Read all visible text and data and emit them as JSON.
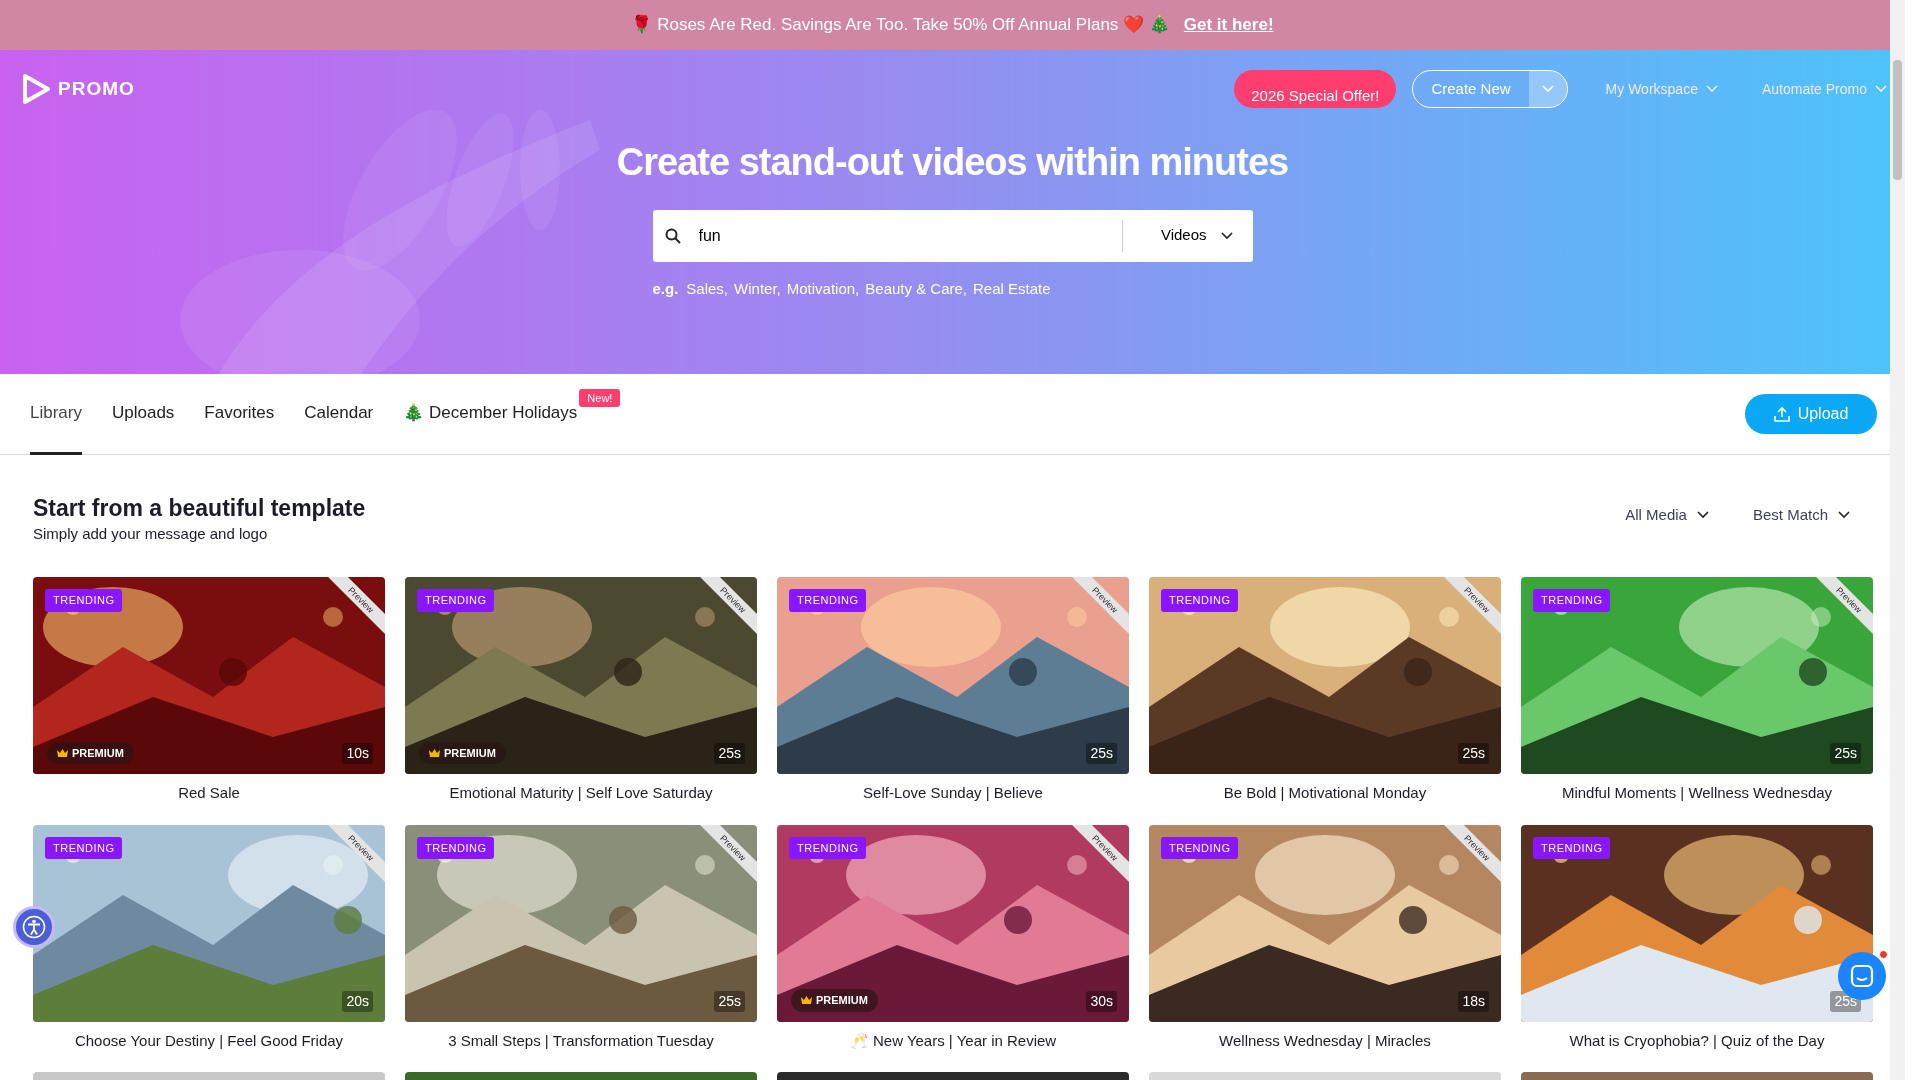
{
  "promo_banner": {
    "text": "🌹 Roses Are Red. Savings Are Too. Take 50% Off Annual Plans ❤️ 🎄",
    "link": "Get it here!"
  },
  "header": {
    "logo": "PROMO",
    "offer_button": "2026 Special Offer!",
    "create_button": "Create New",
    "nav": [
      "My Workspace",
      "Automate Promo"
    ]
  },
  "hero": {
    "title": "Create stand-out videos within minutes",
    "search": {
      "value": "fun",
      "media_type": "Videos"
    },
    "examples_label": "e.g.",
    "examples": [
      "Sales,",
      "Winter,",
      "Motivation,",
      "Beauty & Care,",
      "Real Estate"
    ]
  },
  "tabs": [
    {
      "label": "Library",
      "selected": true
    },
    {
      "label": "Uploads",
      "selected": false
    },
    {
      "label": "Favorites",
      "selected": false
    },
    {
      "label": "Calendar",
      "selected": false
    },
    {
      "label": "🎄 December Holidays",
      "selected": false,
      "badge": "New!"
    }
  ],
  "upload_button": "Upload",
  "section": {
    "title": "Start from a beautiful template",
    "subtitle": "Simply add your message and logo",
    "filters": [
      "All Media",
      "Best Match"
    ]
  },
  "templates": [
    {
      "title": "Red Sale",
      "badge": "TRENDING",
      "premium": "PREMIUM",
      "duration": "10s",
      "ribbon": "Preview"
    },
    {
      "title": "Emotional Maturity | Self Love Saturday",
      "badge": "TRENDING",
      "premium": "PREMIUM",
      "duration": "25s",
      "ribbon": "Preview"
    },
    {
      "title": "Self-Love Sunday | Believe",
      "badge": "TRENDING",
      "duration": "25s",
      "ribbon": "Preview"
    },
    {
      "title": "Be Bold | Motivational Monday",
      "badge": "TRENDING",
      "duration": "25s",
      "ribbon": "Preview"
    },
    {
      "title": "Mindful Moments | Wellness Wednesday",
      "badge": "TRENDING",
      "duration": "25s",
      "ribbon": "Preview"
    },
    {
      "title": "Choose Your Destiny | Feel Good Friday",
      "badge": "TRENDING",
      "duration": "20s",
      "ribbon": "Preview"
    },
    {
      "title": "3 Small Steps | Transformation Tuesday",
      "badge": "TRENDING",
      "duration": "25s",
      "ribbon": "Preview"
    },
    {
      "title": "🥂 New Years | Year in Review",
      "badge": "TRENDING",
      "premium": "PREMIUM",
      "duration": "30s",
      "ribbon": "Preview"
    },
    {
      "title": "Wellness Wednesday | Miracles",
      "badge": "TRENDING",
      "duration": "18s",
      "ribbon": "Preview"
    },
    {
      "title": "What is Cryophobia? | Quiz of the Day",
      "badge": "TRENDING",
      "duration": "25s"
    }
  ]
}
